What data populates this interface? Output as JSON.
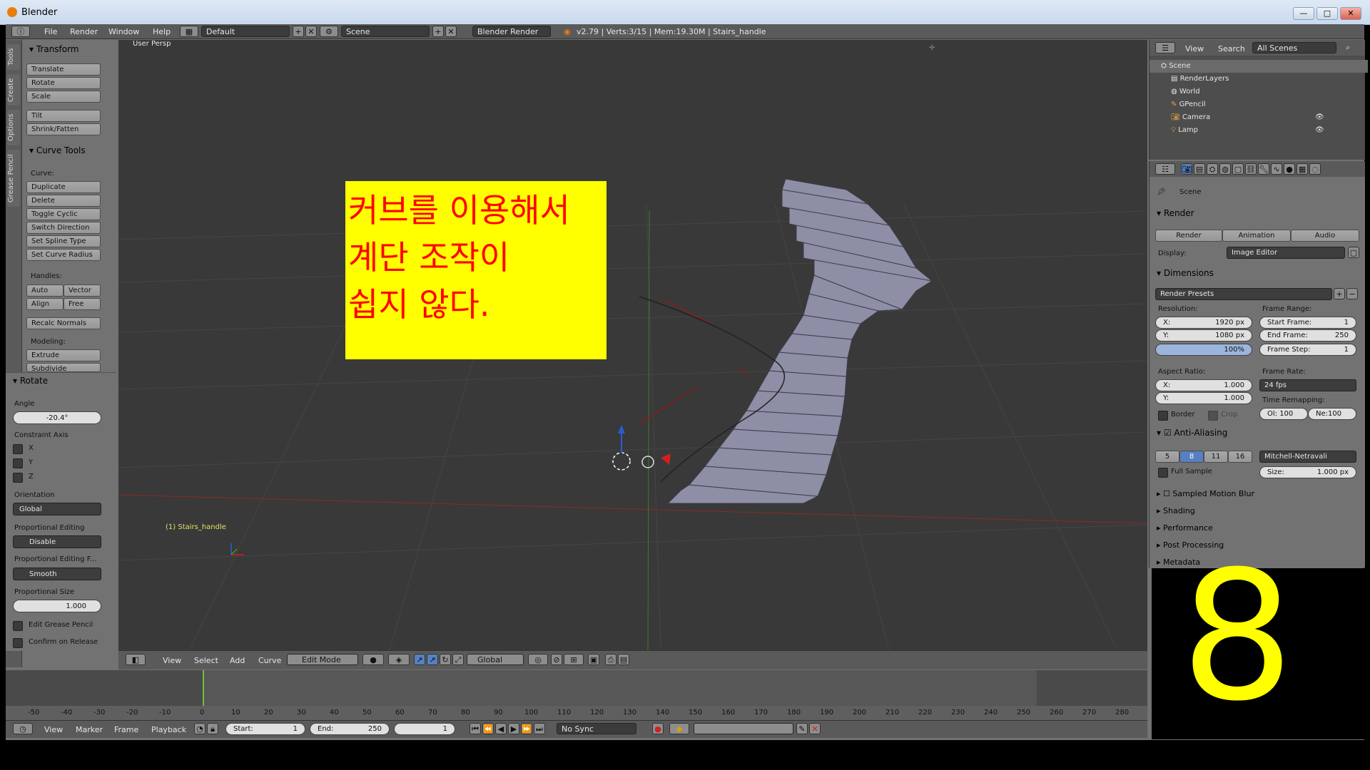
{
  "window": {
    "title": "Blender",
    "min": "—",
    "max": "□",
    "close": "✕"
  },
  "topbar": {
    "menus": [
      "File",
      "Render",
      "Window",
      "Help"
    ],
    "layout": "Default",
    "scene": "Scene",
    "engine": "Blender Render",
    "info": "v2.79 | Verts:3/15 | Mem:19.30M | Stairs_handle"
  },
  "tabs": [
    "Tools",
    "Create",
    "Options",
    "Grease Pencil"
  ],
  "shelf": {
    "transform_header": "Transform",
    "transform": [
      "Translate",
      "Rotate",
      "Scale",
      "Tilt",
      "Shrink/Fatten"
    ],
    "curve_header": "Curve Tools",
    "curve_label": "Curve:",
    "curve": [
      "Duplicate",
      "Delete",
      "Toggle Cyclic",
      "Switch Direction",
      "Set Spline Type",
      "Set Curve Radius"
    ],
    "handles_label": "Handles:",
    "handles": [
      "Auto",
      "Vector",
      "Align",
      "Free"
    ],
    "recalc": "Recalc Normals",
    "modeling_label": "Modeling:",
    "modeling": [
      "Extrude",
      "Subdivide"
    ]
  },
  "operator": {
    "header": "Rotate",
    "angle_label": "Angle",
    "angle": "-20.4°",
    "constraint_label": "Constraint Axis",
    "axes": [
      "X",
      "Y",
      "Z"
    ],
    "orientation_label": "Orientation",
    "orientation": "Global",
    "prop_label": "Proportional Editing",
    "prop": "Disable",
    "falloff_label": "Proportional Editing F...",
    "falloff": "Smooth",
    "size_label": "Proportional Size",
    "size": "1.000",
    "edit_gp": "Edit Grease Pencil",
    "confirm": "Confirm on Release"
  },
  "viewport": {
    "view_name": "User Persp",
    "object_label": "(1) Stairs_handle",
    "note_lines": [
      "커브를 이용해서",
      "계단 조작이",
      "쉽지 않다."
    ],
    "note_bg": "#ffff00",
    "note_color": "#ff0000"
  },
  "vphead": {
    "menus": [
      "View",
      "Select",
      "Add",
      "Curve"
    ],
    "mode": "Edit Mode",
    "orientation": "Global"
  },
  "timeline": {
    "ticks": [
      "-50",
      "-40",
      "-30",
      "-20",
      "-10",
      "0",
      "10",
      "20",
      "30",
      "40",
      "50",
      "60",
      "70",
      "80",
      "90",
      "100",
      "110",
      "120",
      "130",
      "140",
      "150",
      "160",
      "170",
      "180",
      "190",
      "200",
      "210",
      "220",
      "230",
      "240",
      "250",
      "260",
      "270",
      "280"
    ],
    "menus": [
      "View",
      "Marker",
      "Frame",
      "Playback"
    ],
    "start_label": "Start:",
    "start": "1",
    "end_label": "End:",
    "end": "250",
    "current": "1",
    "sync": "No Sync"
  },
  "outliner": {
    "menus": [
      "View",
      "Search"
    ],
    "filter": "All Scenes",
    "items": [
      "Scene",
      "RenderLayers",
      "World",
      "GPencil",
      "Camera",
      "Lamp"
    ]
  },
  "props": {
    "context": "Scene",
    "render_header": "Render",
    "render_buttons": [
      "Render",
      "Animation",
      "Audio"
    ],
    "display_label": "Display:",
    "display": "Image Editor",
    "dimensions_header": "Dimensions",
    "presets": "Render Presets",
    "resolution_label": "Resolution:",
    "res_x": "1920 px",
    "res_y": "1080 px",
    "res_pct": "100%",
    "frame_range_label": "Frame Range:",
    "start_frame": "1",
    "end_frame": "250",
    "frame_step": "1",
    "aspect_label": "Aspect Ratio:",
    "aspect_x": "1.000",
    "aspect_y": "1.000",
    "frame_rate_label": "Frame Rate:",
    "fps": "24 fps",
    "time_remap_label": "Time Remapping:",
    "old": "Ol: 100",
    "new": "Ne:100",
    "border": "Border",
    "crop": "Crop",
    "aa_header": "Anti-Aliasing",
    "aa_samples": [
      "5",
      "8",
      "11",
      "16"
    ],
    "filter": "Mitchell-Netravali",
    "full_sample": "Full Sample",
    "size_label": "Size:",
    "size": "1.000 px",
    "collapsed": [
      "Sampled Motion Blur",
      "Shading",
      "Performance",
      "Post Processing",
      "Metadata"
    ]
  },
  "overlay_number": "8"
}
